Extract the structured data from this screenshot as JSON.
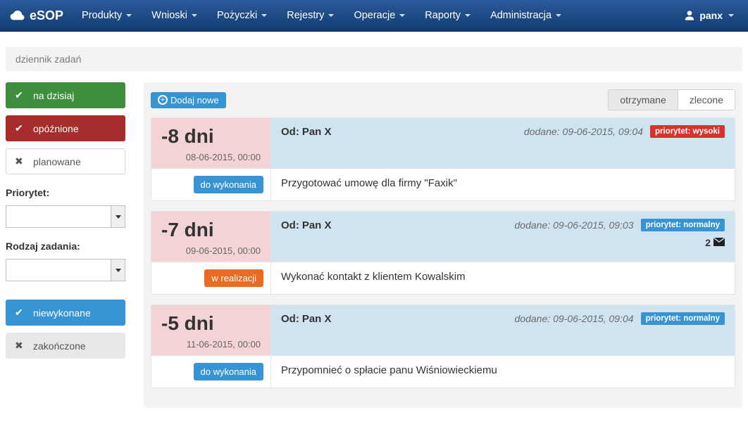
{
  "brand": "eSOP",
  "user": "panx",
  "nav": [
    "Produkty",
    "Wnioski",
    "Pożyczki",
    "Rejestry",
    "Operacje",
    "Raporty",
    "Administracja"
  ],
  "breadcrumb": "dziennik zadań",
  "sidebar": {
    "today": "na   dzisiaj",
    "late": "opóźnione",
    "planned": "planowane",
    "priority_label": "Priorytet:",
    "kind_label": "Rodzaj zadania:",
    "undone": "niewykonane",
    "done": "zakończone"
  },
  "main": {
    "add": "Dodaj nowe",
    "tab_received": "otrzymane",
    "tab_sent": "zlecone"
  },
  "tasks": [
    {
      "delta": "-8 dni",
      "due": "08-06-2015, 00:00",
      "from_label": "Od:",
      "from": "Pan X",
      "added_label": "dodane:",
      "added": "09-06-2015, 09:04",
      "prio_text": "priorytet: wysoki",
      "prio_level": "high",
      "status_text": "do wykonania",
      "status_kind": "blue",
      "desc": "Przygotować umowę dla firmy \"Faxik\"",
      "msg_count": null
    },
    {
      "delta": "-7 dni",
      "due": "09-06-2015, 00:00",
      "from_label": "Od:",
      "from": "Pan X",
      "added_label": "dodane:",
      "added": "09-06-2015, 09:03",
      "prio_text": "priorytet: normalny",
      "prio_level": "normal",
      "status_text": "w realizacji",
      "status_kind": "orange",
      "desc": "Wykonać kontakt z klientem Kowalskim",
      "msg_count": "2"
    },
    {
      "delta": "-5 dni",
      "due": "11-06-2015, 00:00",
      "from_label": "Od:",
      "from": "Pan X",
      "added_label": "dodane:",
      "added": "09-06-2015, 09:04",
      "prio_text": "priorytet: normalny",
      "prio_level": "normal",
      "status_text": "do wykonania",
      "status_kind": "blue",
      "desc": "Przypomnieć o spłacie panu Wiśniowieckiemu",
      "msg_count": null
    }
  ]
}
